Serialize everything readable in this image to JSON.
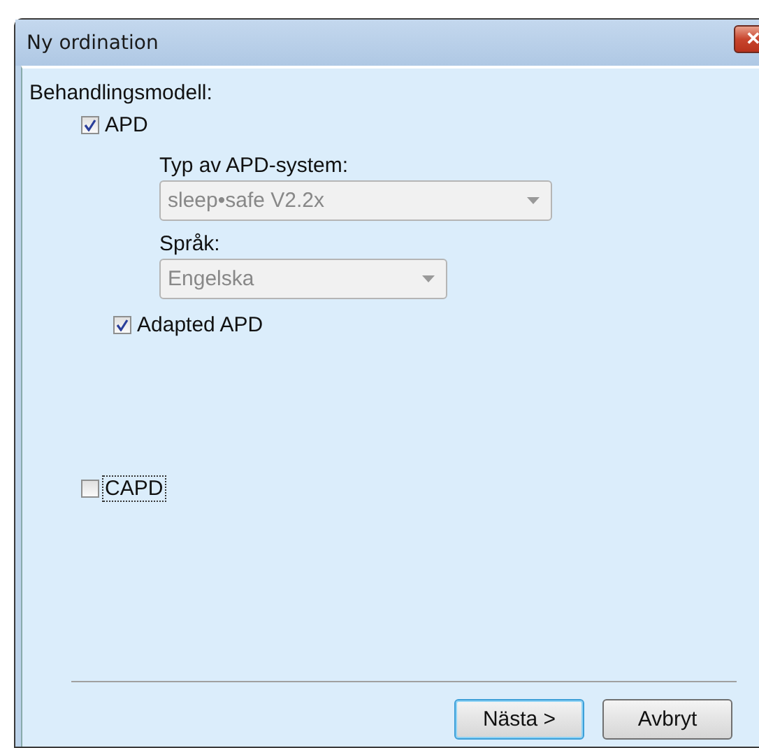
{
  "window": {
    "title": "Ny ordination",
    "close": "✕"
  },
  "heading": "Behandlingsmodell:",
  "apd": {
    "label": "APD",
    "checked": true,
    "focused": false
  },
  "system": {
    "label": "Typ av APD-system:",
    "value": "sleep•safe V2.2x",
    "disabled": true
  },
  "language": {
    "label": "Språk:",
    "value": "Engelska",
    "disabled": true
  },
  "adapted": {
    "label": "Adapted APD",
    "checked": true,
    "focused": false
  },
  "capd": {
    "label": "CAPD",
    "checked": false,
    "focused": true
  },
  "buttons": [
    {
      "label": "Nästa >",
      "default": true
    },
    {
      "label": "Avbryt",
      "default": false
    }
  ]
}
